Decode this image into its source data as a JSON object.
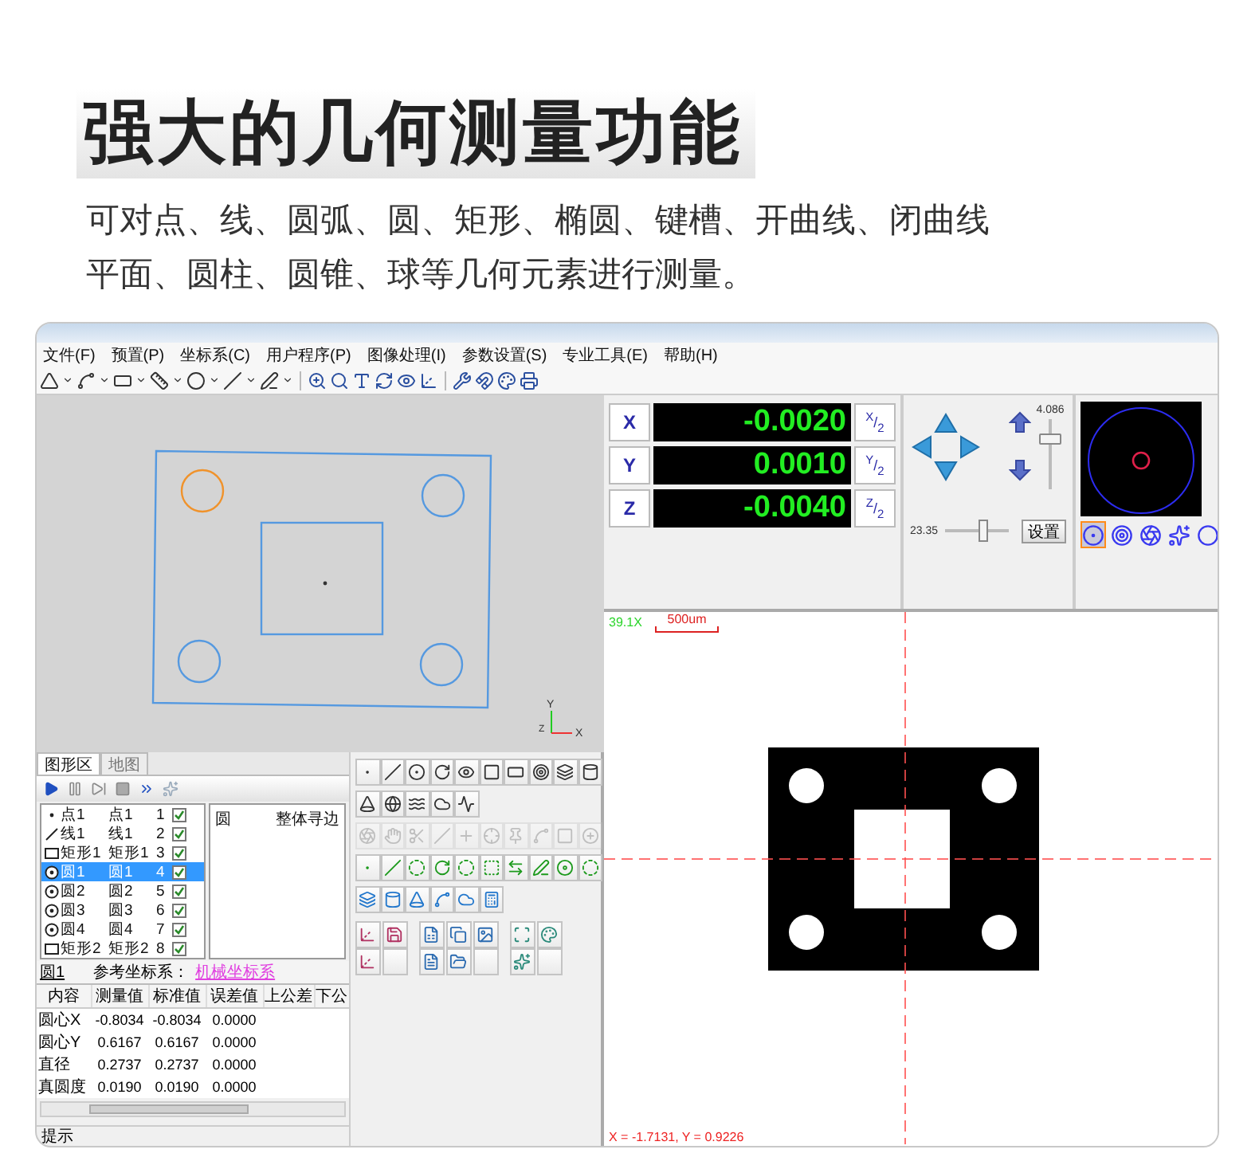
{
  "heading": {
    "title": "强大的几何测量功能",
    "lines": [
      "可对点、线、圆弧、圆、矩形、椭圆、键槽、开曲线、闭曲线",
      "平面、圆柱、圆锥、球等几何元素进行测量。"
    ]
  },
  "menu": [
    "文件(F)",
    "预置(P)",
    "坐标系(C)",
    "用户程序(P)",
    "图像处理(I)",
    "参数设置(S)",
    "专业工具(E)",
    "帮助(H)"
  ],
  "cad_view": {
    "holes": [
      {
        "selected": true
      },
      {
        "selected": false
      },
      {
        "selected": false
      },
      {
        "selected": false
      }
    ],
    "axis_labels": [
      "Y",
      "Z",
      "X"
    ]
  },
  "view_tabs": [
    {
      "label": "图形区",
      "selected": true
    },
    {
      "label": "地图",
      "selected": false
    }
  ],
  "elements": [
    {
      "kind": "point",
      "name": "点1",
      "ref": "点1",
      "index": "1",
      "checked": true,
      "selected": false
    },
    {
      "kind": "line",
      "name": "线1",
      "ref": "线1",
      "index": "2",
      "checked": true,
      "selected": false
    },
    {
      "kind": "rect",
      "name": "矩形1",
      "ref": "矩形1",
      "index": "3",
      "checked": true,
      "selected": false
    },
    {
      "kind": "circle",
      "name": "圆1",
      "ref": "圆1",
      "index": "4",
      "checked": true,
      "selected": true
    },
    {
      "kind": "circle",
      "name": "圆2",
      "ref": "圆2",
      "index": "5",
      "checked": true,
      "selected": false
    },
    {
      "kind": "circle",
      "name": "圆3",
      "ref": "圆3",
      "index": "6",
      "checked": true,
      "selected": false
    },
    {
      "kind": "circle",
      "name": "圆4",
      "ref": "圆4",
      "index": "7",
      "checked": true,
      "selected": false
    },
    {
      "kind": "rect",
      "name": "矩形2",
      "ref": "矩形2",
      "index": "8",
      "checked": true,
      "selected": false
    }
  ],
  "element_detail": [
    "圆",
    "整体寻边"
  ],
  "result_header": {
    "element": "圆1",
    "reference_label": "参考坐标系：",
    "reference_value": "机械坐标系"
  },
  "results": {
    "columns": [
      "内容",
      "测量值",
      "标准值",
      "误差值",
      "上公差",
      "下公"
    ],
    "rows": [
      [
        "圆心X",
        "-0.8034",
        "-0.8034",
        "0.0000",
        "",
        ""
      ],
      [
        "圆心Y",
        "0.6167",
        "0.6167",
        "0.0000",
        "",
        ""
      ],
      [
        "直径",
        "0.2737",
        "0.2737",
        "0.0000",
        "",
        ""
      ],
      [
        "真圆度",
        "0.0190",
        "0.0190",
        "0.0000",
        "",
        ""
      ]
    ]
  },
  "status": "提示",
  "tool_rows": [
    {
      "disabled": false
    },
    {
      "disabled": false
    },
    {
      "disabled": true
    },
    {
      "disabled": false
    },
    {
      "disabled": false
    }
  ],
  "dro": [
    {
      "axis": "X",
      "value": "-0.0020",
      "half": "$^{X}$/$_{2}$"
    },
    {
      "axis": "Y",
      "value": "0.0010",
      "half": "$^{Y}$/$_{2}$"
    },
    {
      "axis": "Z",
      "value": "-0.0040",
      "half": "$^{Z}$/$_{2}$"
    }
  ],
  "zoom_slider": {
    "reading": "4.086",
    "level": 0.75
  },
  "light_slider": {
    "reading": "23.35",
    "level": 0.62
  },
  "settings_button": "设置",
  "camera_modes": [
    {
      "selected": true
    },
    {
      "selected": false
    },
    {
      "selected": false
    },
    {
      "selected": false
    },
    {
      "selected": false
    }
  ],
  "image_view": {
    "magnification": "39.1X",
    "scale": "500um",
    "cursor": "X = -1.7131, Y = 0.9226"
  }
}
